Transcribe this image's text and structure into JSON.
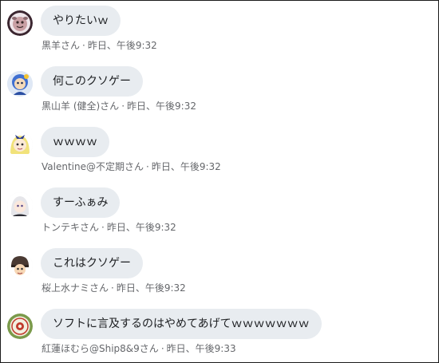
{
  "messages": [
    {
      "text": "やりたいｗ",
      "author": "黒羊さん",
      "separator": "·",
      "time": "昨日、午後9:32",
      "avatar_icon": "sheep-avatar-icon",
      "avatar_color": "#c9a0a4"
    },
    {
      "text": "何このクソゲー",
      "author": "黒山羊 (健全)さん",
      "separator": "·",
      "time": "昨日、午後9:32",
      "avatar_icon": "blue-character-avatar-icon",
      "avatar_color": "#3f6fd1"
    },
    {
      "text": "ｗｗｗｗ",
      "author": "Valentine@不定期さん",
      "separator": "·",
      "time": "昨日、午後9:32",
      "avatar_icon": "blonde-character-avatar-icon",
      "avatar_color": "#f1e27a"
    },
    {
      "text": "すーふぁみ",
      "author": "トンテキさん",
      "separator": "·",
      "time": "昨日、午後9:32",
      "avatar_icon": "white-hair-character-avatar-icon",
      "avatar_color": "#e6e6ea"
    },
    {
      "text": "これはクソゲー",
      "author": "桜上水ナミさん",
      "separator": "·",
      "time": "昨日、午後9:32",
      "avatar_icon": "helmet-character-avatar-icon",
      "avatar_color": "#4a3a33"
    },
    {
      "text": "ソフトに言及するのはやめてあげてｗｗｗｗｗｗｗ",
      "author": "紅蓮ほむら@Ship8&9さん",
      "separator": "·",
      "time": "昨日、午後9:33",
      "avatar_icon": "emblem-avatar-icon",
      "avatar_color": "#7a9a4a"
    }
  ]
}
